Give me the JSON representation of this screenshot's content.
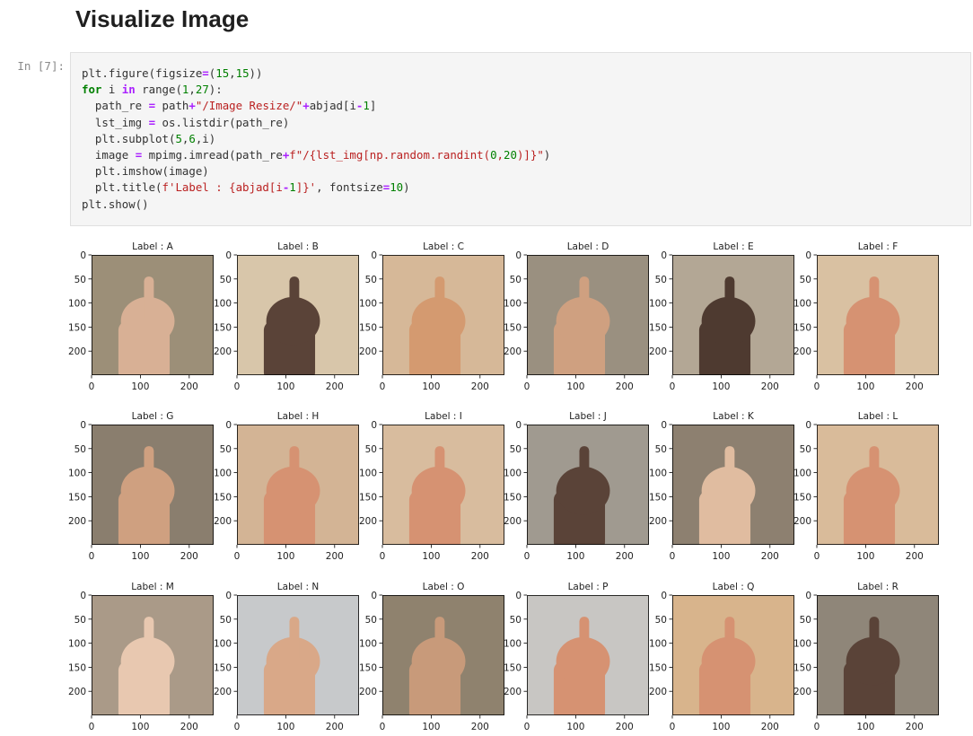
{
  "notebook": {
    "heading": "Visualize Image",
    "cell_prompt": "In [7]:",
    "code_lines": [
      [
        [
          "plt",
          "pl"
        ],
        [
          ".",
          "pl"
        ],
        [
          "figure(figsize",
          "pl"
        ],
        [
          "=",
          "op"
        ],
        [
          "(",
          "pl"
        ],
        [
          "15",
          "num"
        ],
        [
          ",",
          "pl"
        ],
        [
          "15",
          "num"
        ],
        [
          "))",
          "pl"
        ]
      ],
      [
        [
          "for",
          "kw"
        ],
        [
          " i ",
          "pl"
        ],
        [
          "in",
          "op"
        ],
        [
          " range(",
          "pl"
        ],
        [
          "1",
          "num"
        ],
        [
          ",",
          "pl"
        ],
        [
          "27",
          "num"
        ],
        [
          "):",
          "pl"
        ]
      ],
      [
        [
          "  path_re ",
          "pl"
        ],
        [
          "=",
          "op"
        ],
        [
          " path",
          "pl"
        ],
        [
          "+",
          "op"
        ],
        [
          "\"/Image Resize/\"",
          "str"
        ],
        [
          "+",
          "op"
        ],
        [
          "abjad[i",
          "pl"
        ],
        [
          "-",
          "op"
        ],
        [
          "1",
          "num"
        ],
        [
          "]",
          "pl"
        ]
      ],
      [
        [
          "  lst_img ",
          "pl"
        ],
        [
          "=",
          "op"
        ],
        [
          " os.listdir(path_re)",
          "pl"
        ]
      ],
      [
        [
          "  plt.subplot(",
          "pl"
        ],
        [
          "5",
          "num"
        ],
        [
          ",",
          "pl"
        ],
        [
          "6",
          "num"
        ],
        [
          ",i)",
          "pl"
        ]
      ],
      [
        [
          "  image ",
          "pl"
        ],
        [
          "=",
          "op"
        ],
        [
          " mpimg.imread(path_re",
          "pl"
        ],
        [
          "+",
          "op"
        ],
        [
          "f\"/{lst_img[np.random.randint(",
          "str"
        ],
        [
          "0",
          "num"
        ],
        [
          ",",
          "str"
        ],
        [
          "20",
          "num"
        ],
        [
          ")]}\"",
          "str"
        ],
        [
          ")",
          "pl"
        ]
      ],
      [
        [
          "  plt.imshow(image)",
          "pl"
        ]
      ],
      [
        [
          "  plt.title(",
          "pl"
        ],
        [
          "f'Label : {abjad[i",
          "str"
        ],
        [
          "-",
          "op"
        ],
        [
          "1",
          "num"
        ],
        [
          "]}'",
          "str"
        ],
        [
          ", fontsize",
          "pl"
        ],
        [
          "=",
          "op"
        ],
        [
          "10",
          "num"
        ],
        [
          ")",
          "pl"
        ]
      ],
      [
        [
          "plt.show()",
          "pl"
        ]
      ]
    ]
  },
  "chart_data": {
    "type": "image_grid",
    "subplot_layout": [
      5,
      6
    ],
    "visible_rows": 3,
    "titles": [
      "Label : A",
      "Label : B",
      "Label : C",
      "Label : D",
      "Label : E",
      "Label : F",
      "Label : G",
      "Label : H",
      "Label : I",
      "Label : J",
      "Label : K",
      "Label : L",
      "Label : M",
      "Label : N",
      "Label : O",
      "Label : P",
      "Label : Q",
      "Label : R"
    ],
    "x_ticks": [
      0,
      100,
      200
    ],
    "y_ticks": [
      0,
      50,
      100,
      150,
      200
    ],
    "xlim": [
      0,
      250
    ],
    "ylim": [
      250,
      0
    ],
    "image_backgrounds": [
      "#9c8f78",
      "#d8c6aa",
      "#d6b898",
      "#9a9080",
      "#b3a795",
      "#d9c1a2",
      "#8a7e6e",
      "#d3b495",
      "#d8bc9e",
      "#a09a90",
      "#8d8070",
      "#d9bb9a",
      "#aa9a88",
      "#c7c9cb",
      "#8f826e",
      "#c8c6c3",
      "#d8b48c",
      "#8f8679"
    ],
    "hand_colors": [
      "#d8b095",
      "#5a4338",
      "#d49a70",
      "#cfa080",
      "#4e3a30",
      "#d69272",
      "#cfa080",
      "#d69272",
      "#d69272",
      "#5a4338",
      "#e0bca0",
      "#d69272",
      "#e8c8b0",
      "#d9a888",
      "#c89a7a",
      "#d69272",
      "#d69272",
      "#5a4338"
    ]
  }
}
